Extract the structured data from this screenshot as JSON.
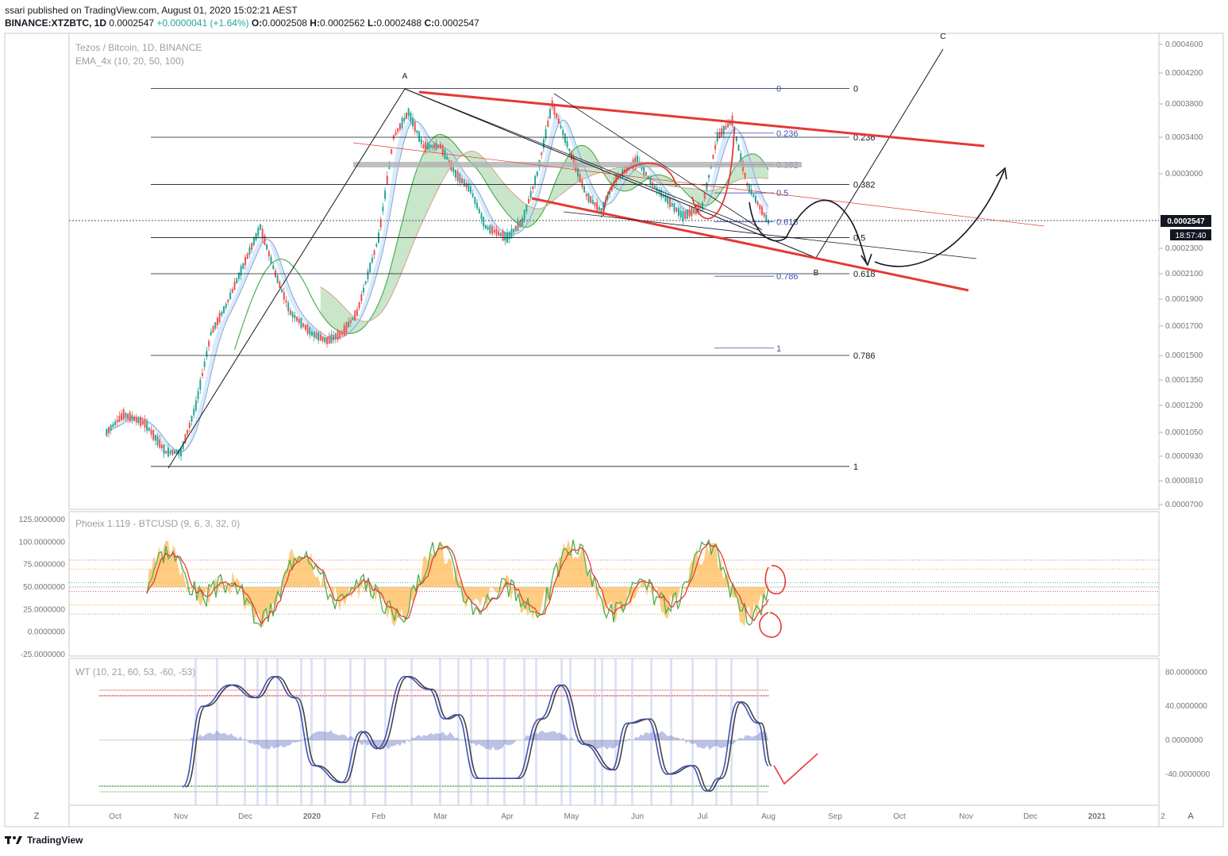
{
  "header": {
    "published": "ssari published on TradingView.com, August 01, 2020 15:02:21 AEST",
    "symbol": "BINANCE:XTZBTC, 1D",
    "last": "0.0002547",
    "change": "+0.0000041 (+1.64%)",
    "o_label": "O:",
    "o": "0.0002508",
    "h_label": "H:",
    "h": "0.0002562",
    "l_label": "L:",
    "l": "0.0002488",
    "c_label": "C:",
    "c": "0.0002547"
  },
  "legend": {
    "main_title": "Tezos / Bitcoin, 1D, BINANCE",
    "ema": "EMA_4x (10, 20, 50, 100)",
    "phoeix": "Phoeix 1.119 - BTCUSD (9, 6, 3, 32, 0)",
    "wt": "WT (10, 21, 60, 53, -60, -53)"
  },
  "price_label": {
    "value": "0.0002547",
    "countdown": "18:57:40"
  },
  "footer": {
    "brand": "TradingView"
  },
  "axis_buttons": {
    "left": "Z",
    "right": "A"
  },
  "colors": {
    "red": "#e53935",
    "green": "#4caf50",
    "blue_fill": "#bbdefb",
    "green_fill": "#a5d6a7",
    "orange": "#ffb74d",
    "wt_blue": "#3f51b5",
    "wt_dark": "#424242",
    "fib": "#3f51b5"
  },
  "chart_data": [
    {
      "type": "line",
      "name": "price",
      "y_axis_ticks": [
        "0.0004600",
        "0.0004200",
        "0.0003800",
        "0.0003400",
        "0.0003000",
        "0.0002300",
        "0.0002100",
        "0.0001900",
        "0.0001700",
        "0.0001500",
        "0.0001350",
        "0.0001200",
        "0.0001050",
        "0.0000930",
        "0.0000810",
        "0.0000700"
      ],
      "y_tick_values": [
        0.00046,
        0.00042,
        0.00038,
        0.00034,
        0.0003,
        0.00023,
        0.00021,
        0.00019,
        0.00017,
        0.00015,
        0.000135,
        0.00012,
        0.000105,
        9.3e-05,
        8.1e-05,
        7e-05
      ],
      "x_axis_ticks": [
        "Oct",
        "Nov",
        "Dec",
        "2020",
        "Feb",
        "Mar",
        "Apr",
        "May",
        "Jun",
        "Jul",
        "Aug",
        "Sep",
        "Oct",
        "Nov",
        "Dec",
        "2021",
        "2"
      ],
      "x": [
        "2019-09-27",
        "2019-10-05",
        "2019-10-15",
        "2019-10-25",
        "2019-11-01",
        "2019-11-08",
        "2019-11-15",
        "2019-11-22",
        "2019-12-01",
        "2019-12-08",
        "2019-12-15",
        "2019-12-22",
        "2020-01-01",
        "2020-01-08",
        "2020-01-15",
        "2020-01-22",
        "2020-02-01",
        "2020-02-08",
        "2020-02-15",
        "2020-02-22",
        "2020-03-01",
        "2020-03-08",
        "2020-03-15",
        "2020-03-22",
        "2020-04-01",
        "2020-04-08",
        "2020-04-15",
        "2020-04-22",
        "2020-05-01",
        "2020-05-08",
        "2020-05-15",
        "2020-05-22",
        "2020-06-01",
        "2020-06-08",
        "2020-06-15",
        "2020-06-22",
        "2020-07-01",
        "2020-07-08",
        "2020-07-15",
        "2020-07-22",
        "2020-08-01"
      ],
      "y": [
        0.000105,
        0.000115,
        0.00011,
        9.5e-05,
        9.5e-05,
        0.00012,
        0.000165,
        0.000185,
        0.00022,
        0.00025,
        0.00021,
        0.00018,
        0.000165,
        0.00016,
        0.000165,
        0.00018,
        0.00024,
        0.00034,
        0.00037,
        0.00033,
        0.00033,
        0.0003,
        0.000285,
        0.00025,
        0.00024,
        0.000255,
        0.0003,
        0.00038,
        0.00032,
        0.00028,
        0.000265,
        0.000295,
        0.000315,
        0.00029,
        0.000275,
        0.00026,
        0.00027,
        0.00034,
        0.00036,
        0.00029,
        0.0002547
      ],
      "annotations": [
        "A",
        "B",
        "C"
      ],
      "fib_left": [
        "0",
        "0.236",
        "0.382",
        "0.5",
        "0.618",
        "0.786",
        "1"
      ],
      "fib_left_prices": [
        0.0004,
        0.00034,
        0.00029,
        0.00024,
        0.00021,
        0.00015,
        8.8e-05
      ],
      "fib_right": [
        "0",
        "0.236",
        "0.382",
        "0.5",
        "0.618",
        "0.786",
        "1"
      ],
      "fib_right_prices": [
        0.0004,
        0.000345,
        0.00031,
        0.000282,
        0.000255,
        0.000208,
        0.000155
      ]
    },
    {
      "type": "line",
      "name": "phoeix",
      "y_axis_ticks": [
        "125.0000000",
        "100.0000000",
        "75.0000000",
        "50.0000000",
        "25.0000000",
        "0.0000000",
        "-25.0000000"
      ],
      "y_tick_values": [
        125,
        100,
        75,
        50,
        25,
        0,
        -25
      ]
    },
    {
      "type": "line",
      "name": "wt",
      "y_axis_ticks": [
        "80.0000000",
        "40.0000000",
        "0.0000000",
        "-40.0000000"
      ],
      "y_tick_values": [
        80,
        40,
        0,
        -40
      ]
    }
  ]
}
